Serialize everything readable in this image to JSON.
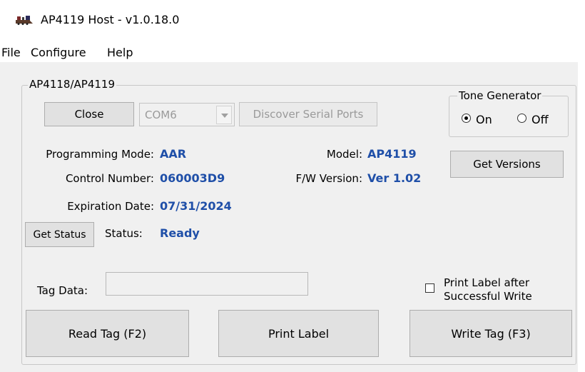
{
  "window": {
    "title": "AP4119 Host - v1.0.18.0",
    "app_icon": "locomotive-icon"
  },
  "menu": {
    "items": [
      "File",
      "Configure",
      "Help"
    ]
  },
  "device_group": {
    "legend": "AP4118/AP4119",
    "close_label": "Close",
    "com_port": "COM6",
    "discover_label": "Discover Serial Ports",
    "programming_mode_label": "Programming Mode:",
    "programming_mode_value": "AAR",
    "control_number_label": "Control Number:",
    "control_number_value": "060003D9",
    "expiration_date_label": "Expiration Date:",
    "expiration_date_value": "07/31/2024",
    "model_label": "Model:",
    "model_value": "AP4119",
    "fw_version_label": "F/W Version:",
    "fw_version_value": "Ver 1.02",
    "get_status_label": "Get Status",
    "status_label": "Status:",
    "status_value": "Ready",
    "get_versions_label": "Get Versions",
    "tag_data_label": "Tag Data:",
    "tag_data_value": "",
    "print_after_write_line1": "Print Label after",
    "print_after_write_line2": "Successful Write",
    "print_after_write_checked": false,
    "read_tag_label": "Read Tag (F2)",
    "print_label_label": "Print Label",
    "write_tag_label": "Write Tag (F3)"
  },
  "tone_generator": {
    "legend": "Tone Generator",
    "on_label": "On",
    "off_label": "Off",
    "selected": "On"
  },
  "colors": {
    "value_blue": "#1f4fa8",
    "window_bg": "#f0f0f0",
    "button_bg": "#e1e1e1"
  }
}
